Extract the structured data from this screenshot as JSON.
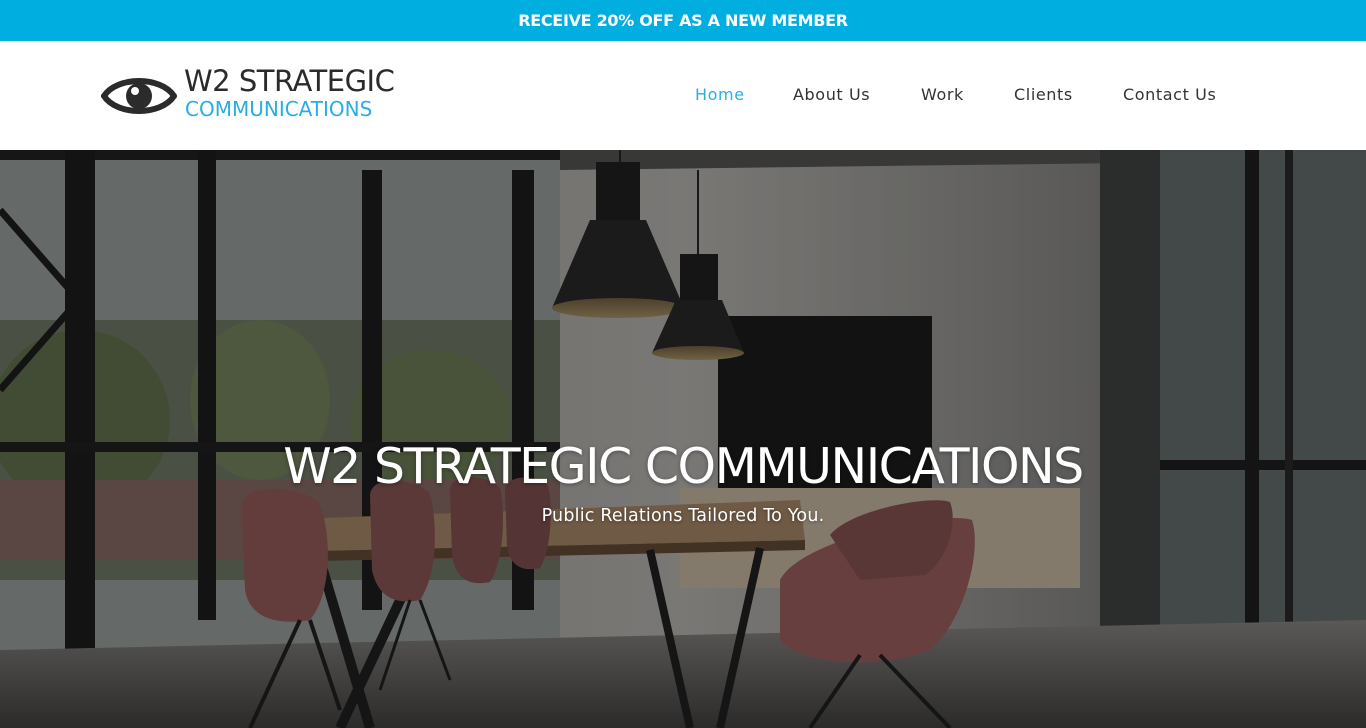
{
  "promo": {
    "text": "RECEIVE 20% OFF AS A NEW MEMBER"
  },
  "brand": {
    "logo_icon": "eye-icon",
    "name_line1": "W2 STRATEGIC",
    "name_line2": "COMMUNICATIONS"
  },
  "nav": {
    "items": [
      {
        "label": "Home",
        "active": true
      },
      {
        "label": "About Us",
        "active": false
      },
      {
        "label": "Work",
        "active": false
      },
      {
        "label": "Clients",
        "active": false
      },
      {
        "label": "Contact Us",
        "active": false
      }
    ]
  },
  "hero": {
    "title": "W2 STRATEGIC COMMUNICATIONS",
    "subtitle": "Public Relations Tailored To You."
  },
  "colors": {
    "accent": "#00aee0",
    "nav_active": "#29aee0",
    "text_dark": "#333333"
  }
}
